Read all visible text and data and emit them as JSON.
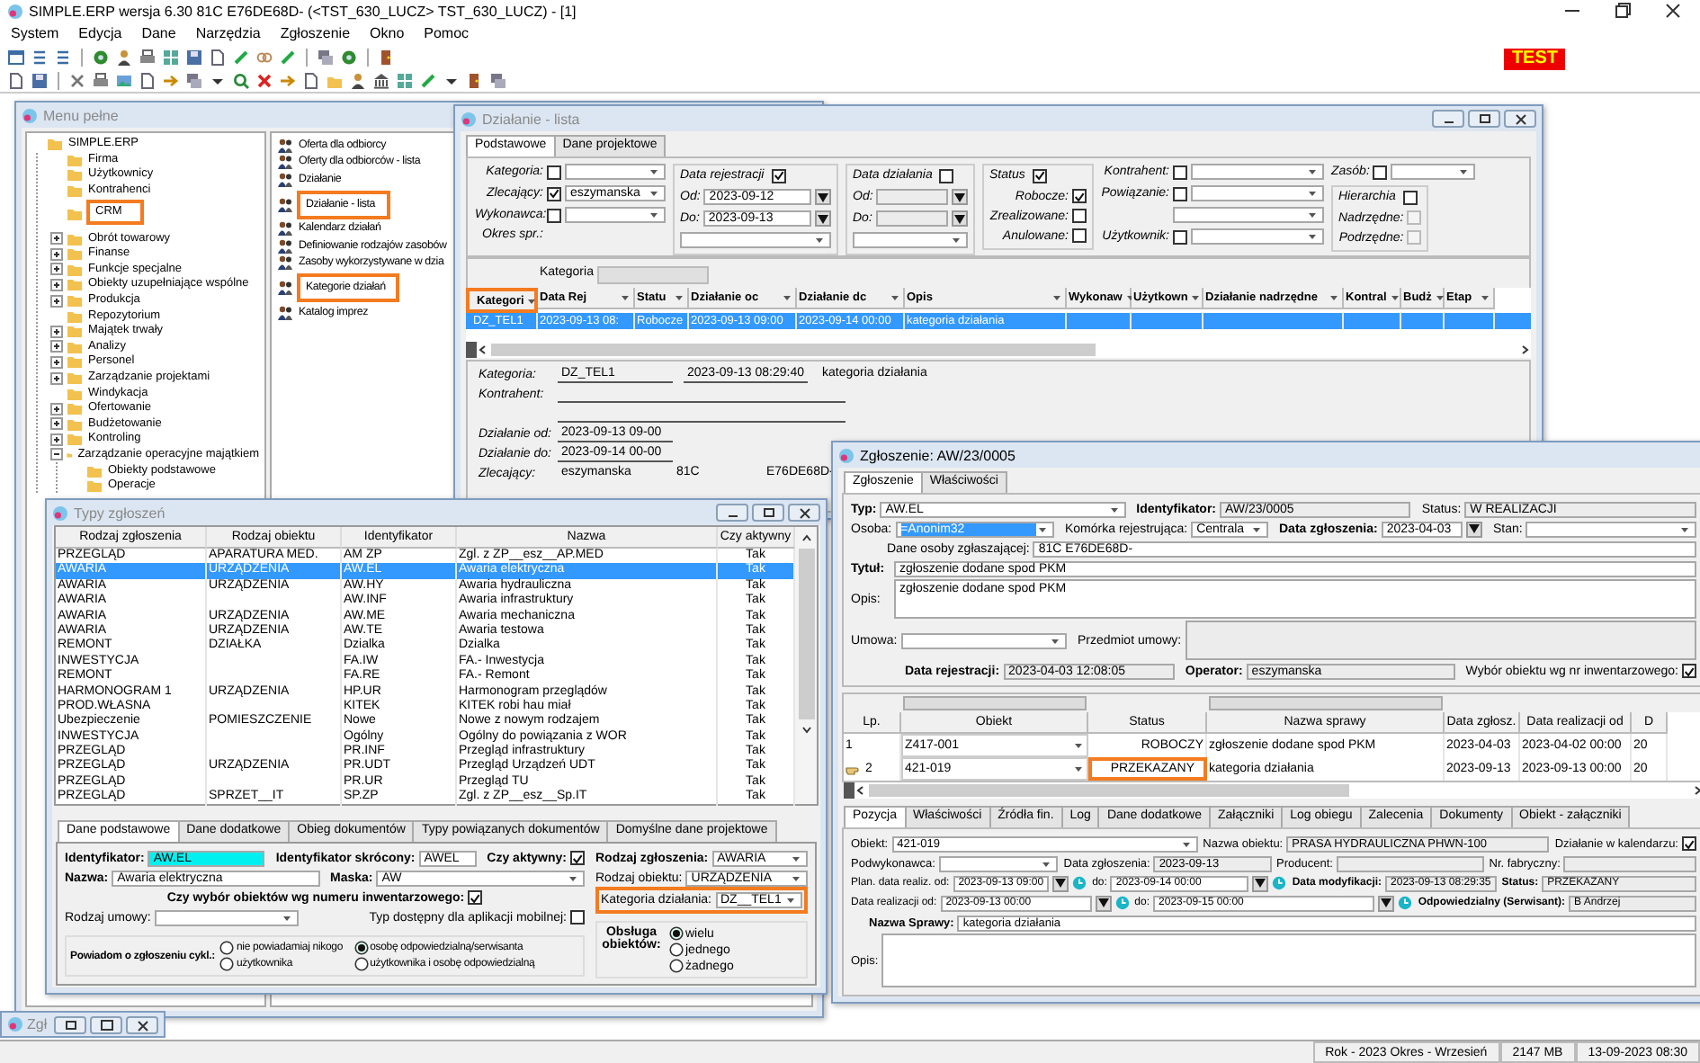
{
  "app": {
    "title": "SIMPLE.ERP wersja 6.30 81C E76DE68D- (<TST_630_LUCZ> TST_630_LUCZ) - [1]",
    "menu": [
      "System",
      "Edycja",
      "Dane",
      "Narzędzia",
      "Zgłoszenie",
      "Okno",
      "Pomoc"
    ],
    "badge": "TEST"
  },
  "menu_window": {
    "title": "Menu pełne",
    "active": false,
    "tree": [
      {
        "label": "SIMPLE.ERP",
        "highlighted": false,
        "children": [
          {
            "label": "Firma",
            "highlighted": false
          },
          {
            "label": "Użytkownicy",
            "highlighted": false
          },
          {
            "label": "Kontrahenci",
            "highlighted": false
          },
          {
            "label": "CRM",
            "highlighted": true
          },
          {
            "label": "Obrót towarowy",
            "highlighted": false,
            "expanded": false
          },
          {
            "label": "Finanse",
            "highlighted": false,
            "expanded": false
          },
          {
            "label": "Funkcje specjalne",
            "highlighted": false,
            "expanded": false
          },
          {
            "label": "Obiekty uzupełniające wspólne",
            "highlighted": false,
            "expanded": false
          },
          {
            "label": "Produkcja",
            "highlighted": false,
            "expanded": false
          },
          {
            "label": "Repozytorium",
            "highlighted": false
          },
          {
            "label": "Majątek trwały",
            "highlighted": false,
            "expanded": false
          },
          {
            "label": "Analizy",
            "highlighted": false,
            "expanded": false
          },
          {
            "label": "Personel",
            "highlighted": false,
            "expanded": false
          },
          {
            "label": "Zarządzanie projektami",
            "highlighted": false,
            "expanded": false
          },
          {
            "label": "Windykacja",
            "highlighted": false
          },
          {
            "label": "Ofertowanie",
            "highlighted": false,
            "expanded": false
          },
          {
            "label": "Budżetowanie",
            "highlighted": false,
            "expanded": false
          },
          {
            "label": "Kontroling",
            "highlighted": false,
            "expanded": false
          },
          {
            "label": "Zarządzanie operacyjne majątkiem",
            "highlighted": false,
            "expanded": true,
            "children": [
              {
                "label": "Obiekty podstawowe",
                "highlighted": false
              },
              {
                "label": "Operacje",
                "highlighted": false
              }
            ]
          }
        ]
      }
    ],
    "actions": [
      {
        "label": "Oferta dla odbiorcy",
        "highlighted": false
      },
      {
        "label": "Oferty dla odbiorców - lista",
        "highlighted": false
      },
      {
        "label": "Działanie",
        "highlighted": false
      },
      {
        "label": "Działanie - lista",
        "highlighted": true
      },
      {
        "label": "Kalendarz działań",
        "highlighted": false
      },
      {
        "label": "Definiowanie rodzajów zasobów",
        "highlighted": false
      },
      {
        "label": "Zasoby wykorzystywane w dzia",
        "highlighted": false
      },
      {
        "label": "Kategorie działań",
        "highlighted": true
      },
      {
        "label": "Katalog imprez",
        "highlighted": false
      }
    ]
  },
  "dzialanie_window": {
    "title": "Działanie - lista",
    "active": false,
    "tabs": [
      {
        "label": "Podstawowe",
        "selected": true
      },
      {
        "label": "Dane projektowe",
        "selected": false
      }
    ],
    "filter_groups": [
      {
        "fields": [
          {
            "kind": "checkcombo",
            "label": "Kategoria:",
            "checked": false
          },
          {
            "kind": "checkcombo",
            "label": "Zlecający:",
            "checked": true,
            "value": "eszymanska"
          },
          {
            "kind": "checkcombo",
            "label": "Wykonawca:",
            "checked": false
          },
          {
            "kind": "caption",
            "label": "Okres spr.:"
          }
        ]
      },
      {
        "title": "Data rejestracji",
        "checked": true,
        "fields": [
          {
            "kind": "date",
            "label": "Od:",
            "value": "2023-09-12"
          },
          {
            "kind": "date",
            "label": "Do:",
            "value": "2023-09-13"
          },
          {
            "kind": "combo"
          }
        ]
      },
      {
        "title": "Data działania",
        "checked": false,
        "fields": [
          {
            "kind": "date",
            "label": "Od:",
            "readonly": true
          },
          {
            "kind": "date",
            "label": "Do:",
            "readonly": true
          },
          {
            "kind": "combo"
          }
        ]
      },
      {
        "title": "Status",
        "checked": true,
        "fields": [
          {
            "kind": "check",
            "label": "Robocze:",
            "checked": true
          },
          {
            "kind": "check",
            "label": "Zrealizowane:",
            "checked": false
          },
          {
            "kind": "check",
            "label": "Anulowane:",
            "checked": false
          }
        ]
      },
      {
        "fields": [
          {
            "kind": "checkcombo",
            "label": "Kontrahent:",
            "checked": false
          },
          {
            "kind": "checkcombo",
            "label": "Powiązanie:",
            "checked": false
          },
          {
            "kind": "combo"
          },
          {
            "kind": "checkcombo",
            "label": "Użytkownik:",
            "checked": false
          }
        ]
      },
      {
        "fields": [
          {
            "kind": "checkcombo",
            "label": "Zasób:",
            "checked": false
          },
          {
            "kind": "group",
            "title": "Hierarchia",
            "checked": false,
            "fields": [
              {
                "kind": "check",
                "label": "Nadrzędne:",
                "checked": false,
                "disabled": true
              },
              {
                "kind": "check",
                "label": "Podrzędne:",
                "checked": false,
                "disabled": true
              }
            ]
          }
        ]
      }
    ],
    "group_label": "Kategoria",
    "table": {
      "columns": [
        {
          "label": "Kategori",
          "highlighted": true
        },
        {
          "label": "Data Rej",
          "highlighted": false
        },
        {
          "label": "Statu",
          "highlighted": false
        },
        {
          "label": "Działanie oc",
          "highlighted": false
        },
        {
          "label": "Działanie dc",
          "highlighted": false
        },
        {
          "label": "Opis",
          "highlighted": false
        },
        {
          "label": "Wykonaw",
          "highlighted": false
        },
        {
          "label": "Użytkown",
          "highlighted": false
        },
        {
          "label": "Działanie nadrzędne",
          "highlighted": false
        },
        {
          "label": "Kontral",
          "highlighted": false
        },
        {
          "label": "Budż",
          "highlighted": false
        },
        {
          "label": "Etap",
          "highlighted": false
        }
      ],
      "rows": [
        {
          "selected": true,
          "cells": [
            "DZ_TEL1",
            "2023-09-13 08:",
            "Robocze",
            "2023-09-13 09:00",
            "2023-09-14 00:00",
            "kategoria działania"
          ]
        }
      ]
    },
    "detail": [
      [
        {
          "kind": "line",
          "label": "Kategoria:",
          "value": "DZ_TEL1"
        },
        {
          "kind": "line",
          "value": "2023-09-13 08:29:40"
        },
        {
          "kind": "plain",
          "value": "kategoria działania"
        }
      ],
      [
        {
          "kind": "line",
          "label": "Kontrahent:"
        }
      ],
      [
        {
          "kind": "line"
        }
      ],
      [
        {
          "kind": "line",
          "label": "Działanie od:",
          "value": "2023-09-13 09-00"
        }
      ],
      [
        {
          "kind": "line",
          "label": "Działanie do:",
          "value": "2023-09-14 00-00"
        }
      ],
      [
        {
          "kind": "plain",
          "label": "Zlecający:",
          "value": "eszymanska"
        },
        {
          "kind": "plain",
          "value": "81C"
        },
        {
          "kind": "plain",
          "value": "E76DE68D-"
        }
      ]
    ]
  },
  "typy_window": {
    "title": "Typy zgłoszeń",
    "active": false,
    "table": {
      "columns": [
        {
          "label": "Rodzaj zgłoszenia"
        },
        {
          "label": "Rodzaj obiektu"
        },
        {
          "label": "Identyfikator"
        },
        {
          "label": "Nazwa"
        },
        {
          "label": "Czy aktywny",
          "kind": "center"
        }
      ],
      "rows": [
        {
          "selected": false,
          "cells": [
            "PRZEGLĄD",
            "APARATURA MED.",
            "AM ZP",
            "Zgl. z ZP__esz__AP.MED",
            "Tak"
          ]
        },
        {
          "selected": true,
          "cells": [
            "AWARIA",
            "URZĄDZENIA",
            "AW.EL",
            "Awaria elektryczna",
            "Tak"
          ]
        },
        {
          "selected": false,
          "cells": [
            "AWARIA",
            "URZĄDZENIA",
            "AW.HY",
            "Awaria hydrauliczna",
            "Tak"
          ]
        },
        {
          "selected": false,
          "cells": [
            "AWARIA",
            null,
            "AW.INF",
            "Awaria infrastruktury",
            "Tak"
          ]
        },
        {
          "selected": false,
          "cells": [
            "AWARIA",
            "URZĄDZENIA",
            "AW.ME",
            "Awaria mechaniczna",
            "Tak"
          ]
        },
        {
          "selected": false,
          "cells": [
            "AWARIA",
            "URZĄDZENIA",
            "AW.TE",
            "Awaria testowa",
            "Tak"
          ]
        },
        {
          "selected": false,
          "cells": [
            "REMONT",
            "DZIAŁKA",
            "Dzialka",
            "Dzialka",
            "Tak"
          ]
        },
        {
          "selected": false,
          "cells": [
            "INWESTYCJA",
            null,
            "FA.IW",
            "FA.- Inwestycja",
            "Tak"
          ]
        },
        {
          "selected": false,
          "cells": [
            "REMONT",
            null,
            "FA.RE",
            "FA.- Remont",
            "Tak"
          ]
        },
        {
          "selected": false,
          "cells": [
            "HARMONOGRAM 1",
            "URZĄDZENIA",
            "HP.UR",
            "Harmonogram przeglądów",
            "Tak"
          ]
        },
        {
          "selected": false,
          "cells": [
            "PROD.WŁASNA",
            null,
            "KITEK",
            "KITEK robi hau miał",
            "Tak"
          ]
        },
        {
          "selected": false,
          "cells": [
            "Ubezpieczenie",
            "POMIESZCZENIE",
            "Nowe",
            "Nowe z nowym rodzajem",
            "Tak"
          ]
        },
        {
          "selected": false,
          "cells": [
            "INWESTYCJA",
            null,
            "Ogólny",
            "Ogólny do powiązania z WOR",
            "Tak"
          ]
        },
        {
          "selected": false,
          "cells": [
            "PRZEGLĄD",
            null,
            "PR.INF",
            "Przegląd infrastruktury",
            "Tak"
          ]
        },
        {
          "selected": false,
          "cells": [
            "PRZEGLĄD",
            "URZĄDZENIA",
            "PR.UDT",
            "Przegląd Urządzeń UDT",
            "Tak"
          ]
        },
        {
          "selected": false,
          "cells": [
            "PRZEGLĄD",
            null,
            "PR.UR",
            "Przegląd TU",
            "Tak"
          ]
        },
        {
          "selected": false,
          "cells": [
            "PRZEGLĄD",
            "SPRZET__IT",
            "SP.ZP",
            "Zgl. z ZP__esz__Sp.IT",
            "Tak"
          ]
        }
      ]
    },
    "tabs": [
      {
        "label": "Dane podstawowe",
        "selected": true
      },
      {
        "label": "Dane dodatkowe",
        "selected": false
      },
      {
        "label": "Obieg dokumentów",
        "selected": false
      },
      {
        "label": "Typy powiązanych dokumentów",
        "selected": false
      },
      {
        "label": "Domyślne dane projektowe",
        "selected": false
      }
    ],
    "left_rows": [
      [
        {
          "kind": "text",
          "label": "Identyfikator:",
          "strong": true,
          "value": "AW.EL",
          "focused": true
        },
        {
          "kind": "text",
          "label": "Identyfikator skrócony:",
          "strong": true,
          "value": "AWEL"
        },
        {
          "kind": "check",
          "label": "Czy aktywny:",
          "strong": true,
          "checked": true
        }
      ],
      [
        {
          "kind": "text",
          "label": "Nazwa:",
          "strong": true,
          "value": "Awaria elektryczna"
        },
        {
          "kind": "combo",
          "label": "Maska:",
          "strong": true,
          "value": "AW"
        }
      ],
      [
        {
          "kind": "check",
          "label": "Czy wybór obiektów wg numeru inwentarzowego:",
          "strong": true,
          "checked": true
        }
      ],
      [
        {
          "kind": "combo",
          "label": "Rodzaj umowy:",
          "strong": false
        },
        {
          "kind": "check",
          "label": "Typ dostępny dla aplikacji mobilnej:",
          "strong": false,
          "checked": false
        }
      ]
    ],
    "right_rows": [
      [
        {
          "kind": "combo",
          "label": "Rodzaj zgłoszenia:",
          "strong": true,
          "value": "AWARIA"
        }
      ],
      [
        {
          "kind": "combo",
          "label": "Rodzaj obiektu:",
          "strong": false,
          "value": "URZĄDZENIA"
        }
      ],
      [
        {
          "kind": "combo",
          "label": "Kategoria działania:",
          "strong": false,
          "value": "DZ__TEL1",
          "highlighted": true
        }
      ]
    ],
    "notify": {
      "label": "Powiadom o zgłoszeniu cykl.:",
      "options": [
        {
          "label": "nie powiadamiaj nikogo",
          "selected": false
        },
        {
          "label": "osobę odpowiedzialną/serwisanta",
          "selected": true
        },
        {
          "label": "użytkownika",
          "selected": false
        },
        {
          "label": "użytkownika i osobę odpowiedzialną",
          "selected": false
        }
      ]
    },
    "handling": {
      "label": "Obsługa obiektów:",
      "options": [
        {
          "label": "wielu",
          "selected": true
        },
        {
          "label": "jednego",
          "selected": false
        },
        {
          "label": "żadnego",
          "selected": false
        }
      ]
    }
  },
  "zgloszenie_window": {
    "title": "Zgłoszenie: AW/23/0005",
    "active": true,
    "tabs": [
      {
        "label": "Zgłoszenie",
        "selected": true
      },
      {
        "label": "Właściwości",
        "selected": false
      }
    ],
    "rows": [
      [
        {
          "kind": "combo",
          "label": "Typ:",
          "strong": true,
          "value": "AW.EL"
        },
        {
          "kind": "text",
          "label": "Identyfikator:",
          "strong": true,
          "value": "AW/23/0005",
          "readonly": true
        },
        {
          "kind": "text",
          "label": "Status:",
          "strong": false,
          "value": "W REALIZACJI",
          "readonly": true
        }
      ],
      [
        {
          "kind": "combo",
          "label": "Osoba:",
          "strong": false,
          "value": "=Anonim32",
          "focused": true
        },
        {
          "kind": "combo",
          "label": "Komórka rejestrująca:",
          "strong": false,
          "value": "Centrala"
        },
        {
          "kind": "date",
          "label": "Data zgłoszenia:",
          "strong": true,
          "value": "2023-04-03"
        },
        {
          "kind": "combo",
          "label": "Stan:",
          "strong": false
        }
      ],
      [
        {
          "kind": "text",
          "label": "Dane osoby zgłaszającej:",
          "strong": false,
          "value": "81C E76DE68D-"
        }
      ],
      [
        {
          "kind": "text",
          "label": "Tytuł:",
          "strong": true,
          "value": "zgłoszenie dodane spod PKM"
        }
      ],
      [
        {
          "kind": "area",
          "label": "Opis:",
          "strong": false,
          "value": "zgłoszenie dodane spod PKM"
        }
      ],
      [
        {
          "kind": "combo",
          "label": "Umowa:",
          "strong": false
        },
        {
          "kind": "area",
          "label": "Przedmiot umowy:",
          "strong": false,
          "readonly": true
        }
      ],
      [
        {
          "kind": "text",
          "label": "Data rejestracji:",
          "strong": true,
          "value": "2023-04-03 12:08:05",
          "readonly": true
        },
        {
          "kind": "text",
          "label": "Operator:",
          "strong": true,
          "value": "eszymanska",
          "readonly": true
        },
        {
          "kind": "check",
          "label": "Wybór obiektu wg nr inwentarzowego:",
          "strong": false,
          "checked": true
        }
      ]
    ],
    "table": {
      "columns": [
        {
          "label": "Lp.",
          "kind": "number"
        },
        {
          "label": "Obiekt",
          "kind": "combo"
        },
        {
          "label": "Status",
          "kind": "status"
        },
        {
          "label": "Nazwa sprawy"
        },
        {
          "label": "Data zgłosz."
        },
        {
          "label": "Data realizacji od"
        },
        {
          "label": "D"
        }
      ],
      "rows": [
        {
          "selected": false,
          "status_highlighted": false,
          "cells": [
            "1",
            "Z417-001",
            "ROBOCZY",
            "zgłoszenie dodane spod PKM",
            "2023-04-03",
            "2023-04-02 00:00",
            "20"
          ]
        },
        {
          "selected": true,
          "status_highlighted": true,
          "cells": [
            "2",
            "421-019",
            "PRZEKAZANY",
            "kategoria działania",
            "2023-09-13",
            "2023-09-13 00:00",
            "20"
          ]
        }
      ]
    },
    "bottom_tabs": [
      {
        "label": "Pozycja",
        "selected": true
      },
      {
        "label": "Właściwości",
        "selected": false
      },
      {
        "label": "Źródła fin.",
        "selected": false
      },
      {
        "label": "Log",
        "selected": false
      },
      {
        "label": "Dane dodatkowe",
        "selected": false
      },
      {
        "label": "Załączniki",
        "selected": false
      },
      {
        "label": "Log obiegu",
        "selected": false
      },
      {
        "label": "Zalecenia",
        "selected": false
      },
      {
        "label": "Dokumenty",
        "selected": false
      },
      {
        "label": "Obiekt - załączniki",
        "selected": false
      }
    ],
    "bottom_rows": [
      [
        {
          "kind": "combo",
          "label": "Obiekt:",
          "strong": false,
          "value": "421-019"
        },
        {
          "kind": "text",
          "label": "Nazwa obiektu:",
          "strong": false,
          "value": "PRASA HYDRAULICZNA PHWN-100",
          "readonly": true
        },
        {
          "kind": "check",
          "label": "Działanie w kalendarzu:",
          "strong": false,
          "checked": true
        }
      ],
      [
        {
          "kind": "combo",
          "label": "Podwykonawca:",
          "strong": false
        },
        {
          "kind": "text",
          "label": "Data zgłoszenia:",
          "strong": false,
          "value": "2023-09-13",
          "readonly": true
        },
        {
          "kind": "text",
          "label": "Producent:",
          "strong": false,
          "readonly": true
        },
        {
          "kind": "text",
          "label": "Nr. fabryczny:",
          "strong": false,
          "readonly": true
        }
      ],
      [
        {
          "kind": "datetime",
          "label": "Plan. data realiz. od:",
          "strong": false,
          "value": "2023-09-13 09:00"
        },
        {
          "kind": "datetime",
          "label": "do:",
          "strong": false,
          "value": "2023-09-14 00:00"
        },
        {
          "kind": "text",
          "label": "Data modyfikacji:",
          "strong": true,
          "value": "2023-09-13 08:29:35",
          "readonly": true
        },
        {
          "kind": "text",
          "label": "Status:",
          "strong": true,
          "value": "PRZEKAZANY",
          "readonly": true
        }
      ],
      [
        {
          "kind": "datetime",
          "label": "Data realizacji od:",
          "strong": false,
          "value": "2023-09-13 00:00"
        },
        {
          "kind": "datetime",
          "label": "do:",
          "strong": false,
          "value": "2023-09-15 00:00"
        },
        {
          "kind": "text",
          "label": "Odpowiedzialny (Serwisant):",
          "strong": true,
          "value": "B Andrzej",
          "readonly": true
        }
      ],
      [
        {
          "kind": "text",
          "label": "Nazwa Sprawy:",
          "strong": true,
          "value": "kategoria działania"
        }
      ],
      [
        {
          "kind": "area",
          "label": "Opis:",
          "strong": false
        }
      ]
    ]
  },
  "minimized_window": {
    "title": "Zgł"
  },
  "status_bar": [
    "Rok - 2023 Okres - Wrzesień",
    "2147 MB",
    "13-09-2023 08:30"
  ]
}
